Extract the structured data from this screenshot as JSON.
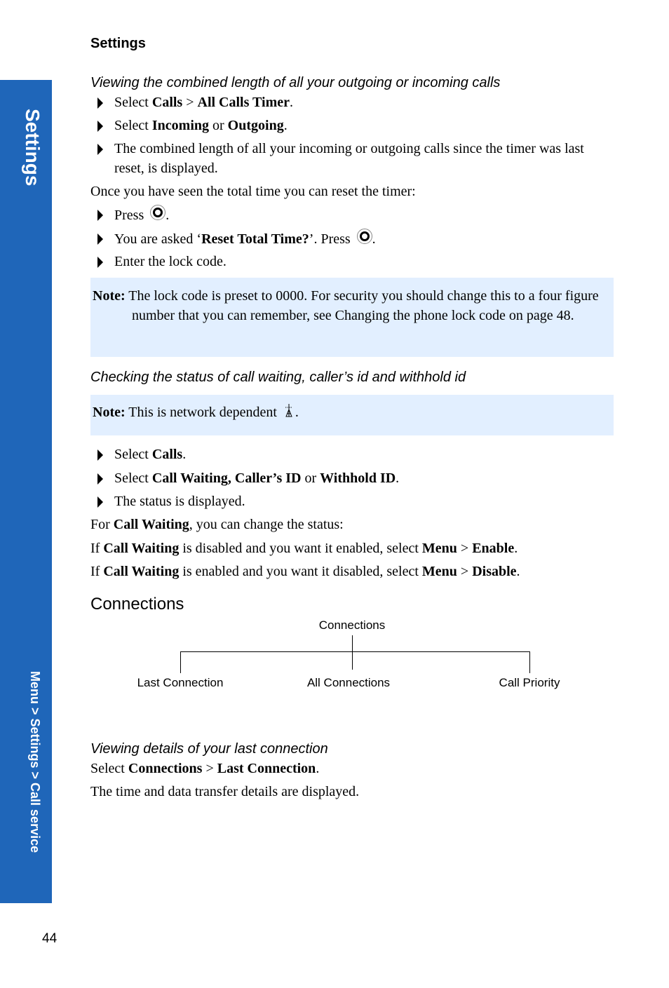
{
  "header": {
    "title": "Settings"
  },
  "sidebar": {
    "title": "Settings",
    "breadcrumb": "Menu > Settings > Call service",
    "color": "#1f66b9"
  },
  "section1": {
    "heading": "Viewing the combined length of all your outgoing or incoming calls",
    "bullets": [
      {
        "parts": [
          "Select ",
          "Calls",
          " > ",
          "All Calls Timer",
          "."
        ]
      },
      {
        "parts": [
          "Select ",
          "Incoming",
          " or ",
          "Outgoing",
          "."
        ]
      },
      {
        "text": "The combined length of all your incoming or outgoing calls since the timer was last reset, is displayed."
      }
    ],
    "reset_intro": "Once you have seen the total time you can reset the timer:",
    "reset_bullets": [
      {
        "before": "Press ",
        "icon": "ok-key-icon",
        "after": "."
      },
      {
        "before": "You are asked ‘",
        "bold": "Reset Total Time?",
        "mid": "’. Press ",
        "icon": "ok-key-icon",
        "after": "."
      },
      {
        "text": "Enter the lock code."
      }
    ],
    "note": {
      "label": "Note:",
      "text": "The lock code is preset to 0000. For security you should change this to a four figure number that you can remember, see Changing the phone lock code on page 48."
    }
  },
  "section2": {
    "heading": "Checking the status of call waiting, caller’s id and withhold id",
    "note": {
      "label": "Note:",
      "text": "This is network dependent",
      "icon": "network-antenna-icon",
      "after": "."
    },
    "bullets": [
      {
        "parts": [
          "Select ",
          "Calls",
          "."
        ]
      },
      {
        "parts": [
          "Select ",
          "Call Waiting",
          ", ",
          "Caller’s ID",
          " or ",
          "Withhold ID",
          "."
        ]
      },
      {
        "text": "The status is displayed."
      }
    ],
    "paras": [
      {
        "parts": [
          "For ",
          "Call Waiting",
          ", you can change the status:"
        ]
      },
      {
        "parts": [
          "If ",
          "Call Waiting",
          " is disabled and you want it enabled, select ",
          "Menu",
          " > ",
          "Enable",
          "."
        ]
      },
      {
        "parts": [
          "If ",
          "Call Waiting",
          " is enabled and you want it disabled, select ",
          "Menu",
          " > ",
          "Disable",
          "."
        ]
      }
    ]
  },
  "connections": {
    "title": "Connections",
    "diagram": {
      "root": "Connections",
      "children": [
        "Last Connection",
        "All Connections",
        "Call Priority"
      ]
    }
  },
  "section3": {
    "heading": "Viewing details of your last connection",
    "line1": {
      "parts": [
        "Select ",
        "Connections",
        " > ",
        "Last Connection",
        "."
      ]
    },
    "line2": "The time and data transfer details are displayed."
  },
  "page_number": "44",
  "colors": {
    "note_bg": "#e2efff",
    "sidebar": "#1f66b9"
  }
}
